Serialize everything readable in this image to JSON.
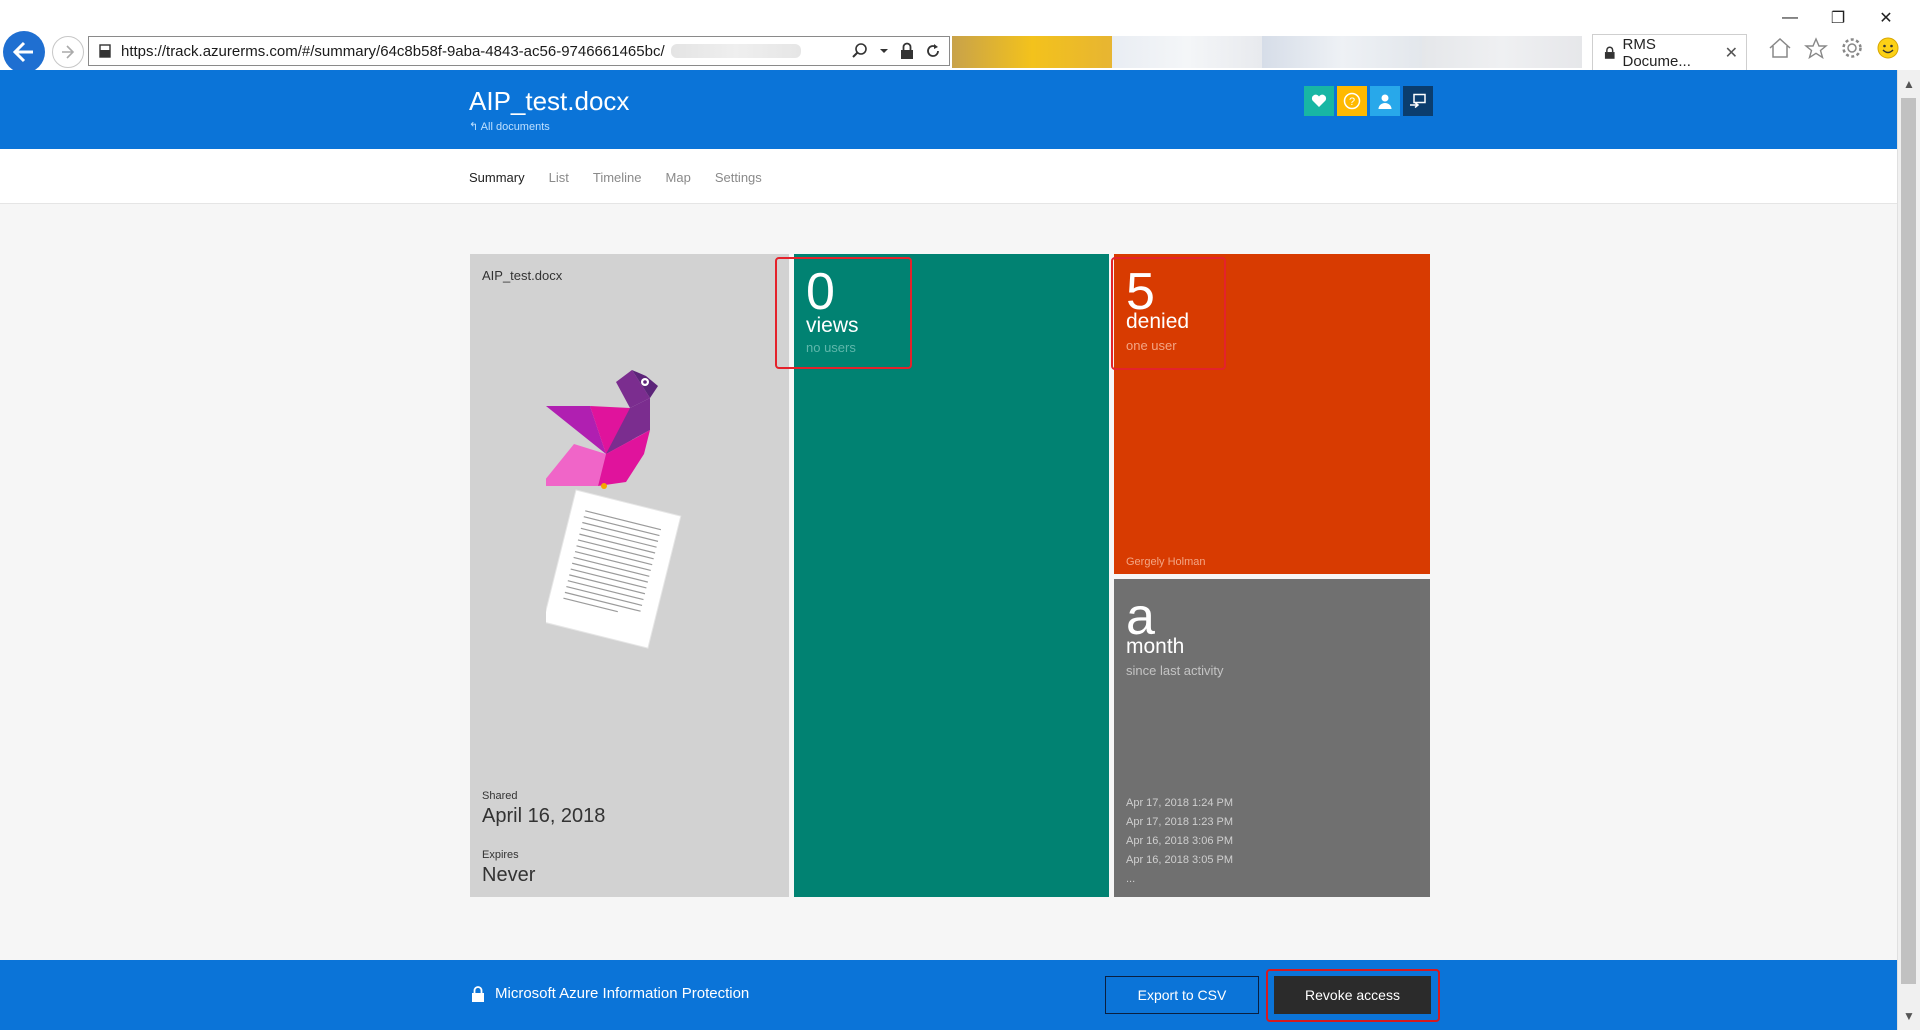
{
  "browser": {
    "url": "https://track.azurerms.com/#/summary/64c8b58f-9aba-4843-ac56-9746661465bc/",
    "active_tab_title": "RMS Docume...",
    "window_controls": {
      "minimize": "—",
      "restore": "❐",
      "close": "✕"
    }
  },
  "header": {
    "doc_title": "AIP_test.docx",
    "back_link": "All documents",
    "icons": [
      "heart-icon",
      "help-icon",
      "user-icon",
      "signout-icon"
    ],
    "icon_colors": [
      "#18b6a4",
      "#ffb900",
      "#28a8ea",
      "#0b3d6e"
    ]
  },
  "nav": {
    "items": [
      "Summary",
      "List",
      "Timeline",
      "Map",
      "Settings"
    ],
    "active": "Summary"
  },
  "tiles": {
    "document": {
      "name": "AIP_test.docx",
      "shared_label": "Shared",
      "shared_value": "April 16, 2018",
      "expires_label": "Expires",
      "expires_value": "Never"
    },
    "views": {
      "count": "0",
      "label": "views",
      "sub": "no users",
      "color": "#018272"
    },
    "denied": {
      "count": "5",
      "label": "denied",
      "sub": "one user",
      "user": "Gergely Holman",
      "color": "#d83b01"
    },
    "activity": {
      "count": "a",
      "label": "month",
      "sub": "since last activity",
      "entries": [
        "Apr 17, 2018 1:24 PM",
        "Apr 17, 2018 1:23 PM",
        "Apr 16, 2018 3:06 PM",
        "Apr 16, 2018 3:05 PM",
        "..."
      ],
      "color": "#707070"
    }
  },
  "footer": {
    "brand": "Microsoft Azure Information Protection",
    "export_label": "Export to CSV",
    "revoke_label": "Revoke access"
  }
}
